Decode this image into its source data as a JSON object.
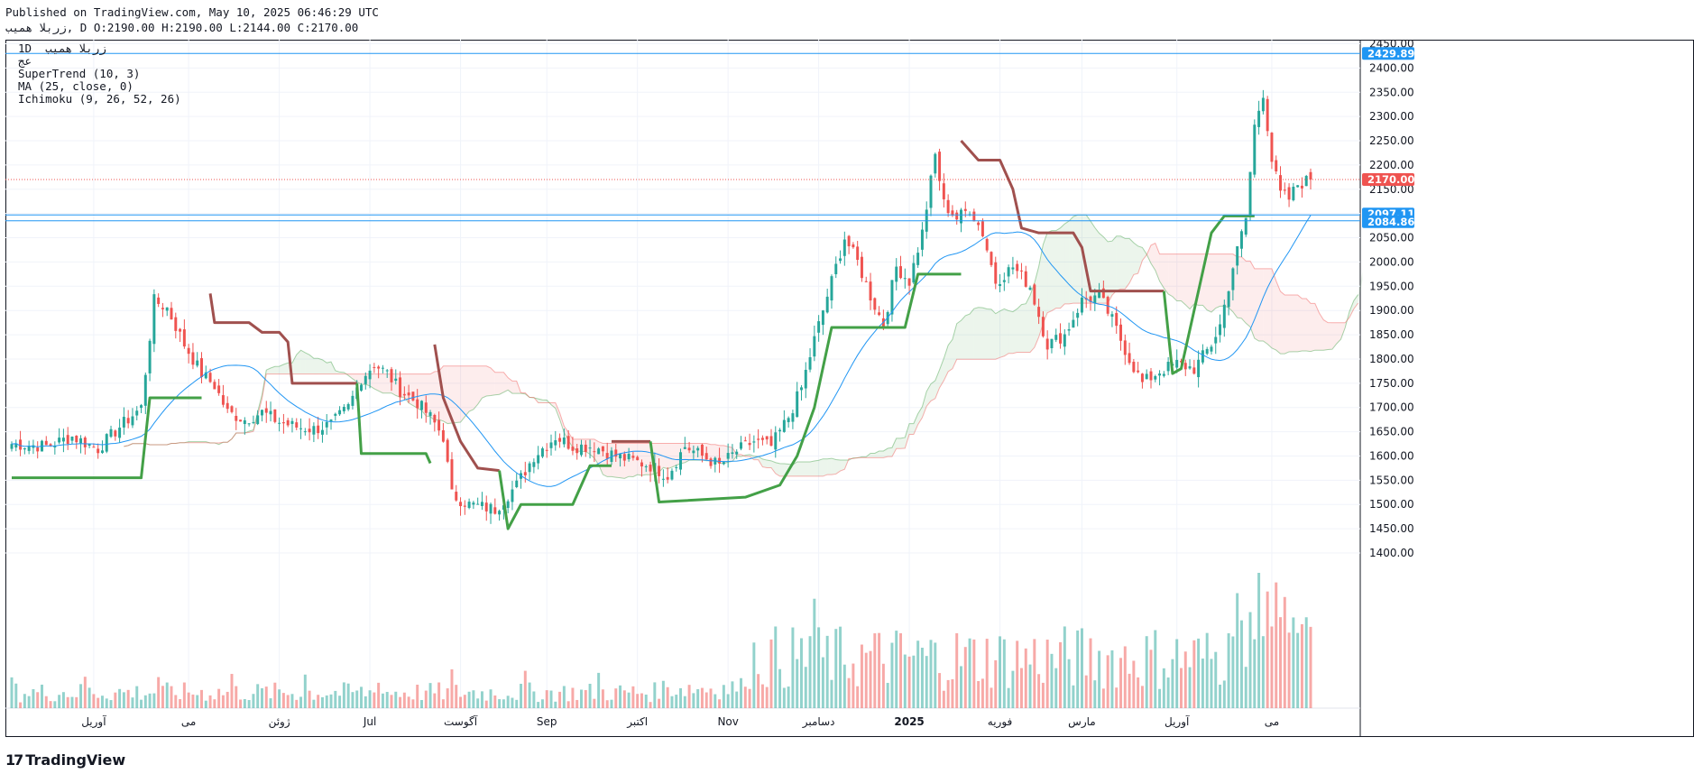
{
  "header": {
    "published": "Published on TradingView.com, May 10, 2025 06:46:29 UTC",
    "ohlc": "زربلا همیب, D O:2190.00 H:2190.00 L:2144.00 C:2170.00"
  },
  "legend": {
    "symbol": "1D  زربلا همیب",
    "subtitle": "عج",
    "supertrend": "SuperTrend (10, 3)",
    "ma": "MA (25, close, 0)",
    "ichimoku": "Ichimoku (9, 26, 52, 26)"
  },
  "footer": {
    "brand": "TradingView",
    "logo_icon": "tradingview-logo-icon"
  },
  "colors": {
    "up": "#26a69a",
    "down": "#ef5350",
    "supertrend_up": "#43a047",
    "supertrend_down": "#a0504e",
    "ma": "#2196f3",
    "horizontal_line": "#2196f3"
  },
  "chart_data": {
    "type": "candlestick",
    "symbol": "زربلا همیب",
    "interval": "1D",
    "price_axis": {
      "ylim": [
        1360,
        2460
      ],
      "ticks": [
        2450,
        2400,
        2350,
        2300,
        2250,
        2200,
        2150,
        2100,
        2050,
        2000,
        1950,
        1900,
        1850,
        1800,
        1750,
        1700,
        1650,
        1600,
        1550,
        1500,
        1450,
        1400
      ],
      "tick_labels": [
        "2450.00",
        "2400.00",
        "2350.00",
        "2300.00",
        "2250.00",
        "2200.00",
        "2150.00",
        "2100.00",
        "2050.00",
        "2000.00",
        "1950.00",
        "1900.00",
        "1850.00",
        "1800.00",
        "1750.00",
        "1700.00",
        "1650.00",
        "1600.00",
        "1550.00",
        "1500.00",
        "1450.00",
        "1400.00"
      ]
    },
    "time_axis": {
      "labels": [
        "آوریل",
        "می",
        "ژوئن",
        "Jul",
        "آگوست",
        "Sep",
        "اکتبر",
        "Nov",
        "دسامبر",
        "2025",
        "فوریه",
        "مارس",
        "آوریل",
        "می"
      ],
      "label_bar_index": [
        19,
        41,
        62,
        83,
        104,
        124,
        145,
        166,
        187,
        208,
        229,
        248,
        270,
        292
      ]
    },
    "horizontal_lines": [
      {
        "price": 2429.89,
        "label": "2429.89"
      },
      {
        "price": 2097.11,
        "label": "2097.11"
      },
      {
        "price": 2084.86,
        "label": "2084.86"
      }
    ],
    "last_price": {
      "price": 2170.0,
      "label": "2170.00"
    },
    "bar_count": 302,
    "close_anchors": [
      [
        0,
        1625
      ],
      [
        8,
        1620
      ],
      [
        14,
        1640
      ],
      [
        20,
        1615
      ],
      [
        25,
        1660
      ],
      [
        30,
        1700
      ],
      [
        33,
        1920
      ],
      [
        36,
        1905
      ],
      [
        40,
        1830
      ],
      [
        44,
        1770
      ],
      [
        47,
        1745
      ],
      [
        50,
        1690
      ],
      [
        54,
        1675
      ],
      [
        58,
        1690
      ],
      [
        62,
        1670
      ],
      [
        66,
        1660
      ],
      [
        70,
        1655
      ],
      [
        74,
        1665
      ],
      [
        78,
        1700
      ],
      [
        81,
        1760
      ],
      [
        84,
        1790
      ],
      [
        87,
        1770
      ],
      [
        90,
        1735
      ],
      [
        94,
        1710
      ],
      [
        97,
        1680
      ],
      [
        100,
        1640
      ],
      [
        102,
        1520
      ],
      [
        106,
        1500
      ],
      [
        112,
        1490
      ],
      [
        117,
        1540
      ],
      [
        121,
        1600
      ],
      [
        126,
        1640
      ],
      [
        130,
        1620
      ],
      [
        135,
        1620
      ],
      [
        140,
        1600
      ],
      [
        144,
        1590
      ],
      [
        148,
        1580
      ],
      [
        152,
        1560
      ],
      [
        156,
        1620
      ],
      [
        160,
        1600
      ],
      [
        164,
        1580
      ],
      [
        168,
        1610
      ],
      [
        172,
        1630
      ],
      [
        176,
        1620
      ],
      [
        180,
        1680
      ],
      [
        183,
        1740
      ],
      [
        186,
        1840
      ],
      [
        190,
        1960
      ],
      [
        193,
        2050
      ],
      [
        196,
        2000
      ],
      [
        199,
        1930
      ],
      [
        202,
        1870
      ],
      [
        205,
        1990
      ],
      [
        208,
        1960
      ],
      [
        211,
        2060
      ],
      [
        214,
        2220
      ],
      [
        216,
        2120
      ],
      [
        219,
        2090
      ],
      [
        222,
        2110
      ],
      [
        225,
        2060
      ],
      [
        228,
        1960
      ],
      [
        232,
        1990
      ],
      [
        236,
        1950
      ],
      [
        240,
        1830
      ],
      [
        244,
        1850
      ],
      [
        248,
        1920
      ],
      [
        252,
        1930
      ],
      [
        255,
        1880
      ],
      [
        259,
        1800
      ],
      [
        262,
        1750
      ],
      [
        266,
        1775
      ],
      [
        270,
        1790
      ],
      [
        274,
        1780
      ],
      [
        278,
        1830
      ],
      [
        280,
        1870
      ],
      [
        283,
        1990
      ],
      [
        286,
        2090
      ],
      [
        288,
        2280
      ],
      [
        290,
        2350
      ],
      [
        292,
        2210
      ],
      [
        294,
        2140
      ],
      [
        296,
        2130
      ],
      [
        298,
        2160
      ],
      [
        301,
        2170
      ]
    ],
    "supertrend_segments": [
      {
        "dir": "up",
        "points": [
          [
            0,
            1555
          ],
          [
            30,
            1555
          ],
          [
            32,
            1720
          ],
          [
            44,
            1720
          ]
        ]
      },
      {
        "dir": "down",
        "points": [
          [
            46,
            1935
          ],
          [
            47,
            1875
          ],
          [
            55,
            1875
          ],
          [
            58,
            1855
          ],
          [
            62,
            1855
          ],
          [
            64,
            1835
          ],
          [
            65,
            1750
          ],
          [
            80,
            1750
          ]
        ]
      },
      {
        "dir": "up",
        "points": [
          [
            80,
            1750
          ],
          [
            81,
            1605
          ],
          [
            96,
            1605
          ],
          [
            97,
            1585
          ]
        ]
      },
      {
        "dir": "down",
        "points": [
          [
            98,
            1830
          ],
          [
            100,
            1720
          ],
          [
            104,
            1630
          ],
          [
            108,
            1575
          ],
          [
            113,
            1570
          ]
        ]
      },
      {
        "dir": "up",
        "points": [
          [
            113,
            1570
          ],
          [
            115,
            1450
          ],
          [
            118,
            1500
          ],
          [
            130,
            1500
          ],
          [
            134,
            1580
          ],
          [
            139,
            1580
          ]
        ]
      },
      {
        "dir": "down",
        "points": [
          [
            139,
            1630
          ],
          [
            148,
            1630
          ]
        ]
      },
      {
        "dir": "up",
        "points": [
          [
            148,
            1630
          ],
          [
            150,
            1505
          ],
          [
            170,
            1515
          ],
          [
            178,
            1540
          ],
          [
            182,
            1600
          ],
          [
            186,
            1700
          ],
          [
            190,
            1865
          ],
          [
            207,
            1865
          ],
          [
            210,
            1975
          ],
          [
            220,
            1975
          ]
        ]
      },
      {
        "dir": "down",
        "points": [
          [
            220,
            2250
          ],
          [
            224,
            2210
          ],
          [
            229,
            2210
          ],
          [
            232,
            2150
          ],
          [
            234,
            2070
          ],
          [
            238,
            2060
          ],
          [
            246,
            2060
          ],
          [
            248,
            2030
          ],
          [
            250,
            1940
          ],
          [
            267,
            1940
          ]
        ]
      },
      {
        "dir": "up",
        "points": [
          [
            267,
            1940
          ],
          [
            269,
            1770
          ],
          [
            271,
            1780
          ],
          [
            274,
            1900
          ],
          [
            278,
            2060
          ],
          [
            281,
            2095
          ],
          [
            288,
            2095
          ]
        ]
      }
    ],
    "volume": {
      "scale_max": 1620
    }
  }
}
